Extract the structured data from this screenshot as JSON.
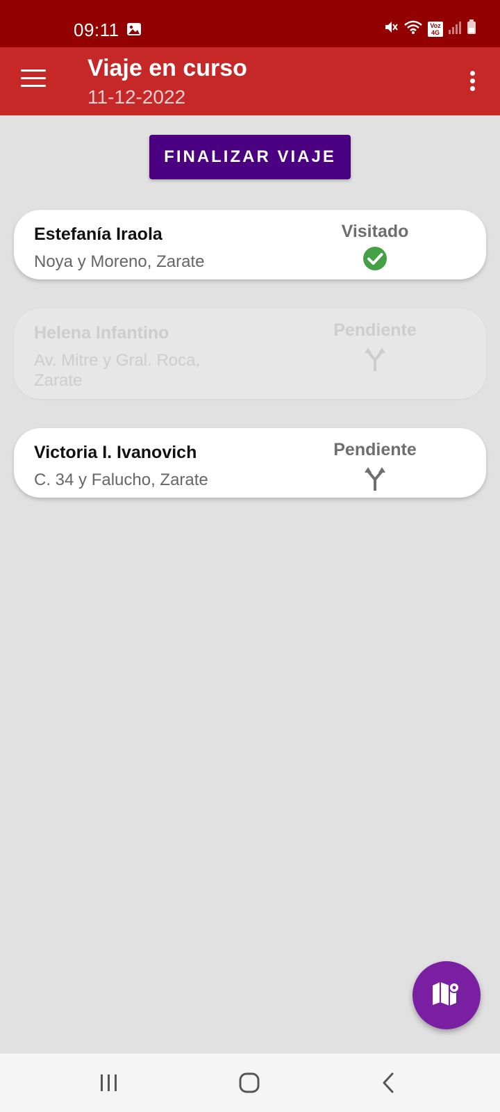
{
  "status_bar": {
    "time": "09:11",
    "network_label": "Voz 4G",
    "icons": [
      "gallery-icon",
      "mute-icon",
      "wifi-icon",
      "signal-icon",
      "battery-icon"
    ]
  },
  "app_bar": {
    "title": "Viaje en curso",
    "subtitle": "11-12-2022",
    "menu_icon": "hamburger-menu-icon",
    "overflow_icon": "more-vert-icon"
  },
  "actions": {
    "finalize_label": "FINALIZAR VIAJE"
  },
  "stops": [
    {
      "name": "Estefanía Iraola",
      "address": "Noya y Moreno, Zarate",
      "status": "Visitado",
      "icon": "check-circle-icon",
      "enabled": true
    },
    {
      "name": "Helena Infantino",
      "address": "Av. Mitre y Gral. Roca, Zarate",
      "status": "Pendiente",
      "icon": "route-fork-icon",
      "enabled": false
    },
    {
      "name": "Victoria I. Ivanovich",
      "address": "C. 34 y Falucho, Zarate",
      "status": "Pendiente",
      "icon": "route-fork-icon",
      "enabled": true
    }
  ],
  "fab": {
    "icon": "map-icon"
  },
  "nav_bar": {
    "icons": [
      "recent-apps-icon",
      "home-icon",
      "back-icon"
    ]
  },
  "colors": {
    "status_bar": "#920000",
    "app_bar": "#c62828",
    "primary_button": "#4a0080",
    "fab": "#7b1fa2",
    "visited_check": "#43a047",
    "background": "#e1e1e1"
  }
}
